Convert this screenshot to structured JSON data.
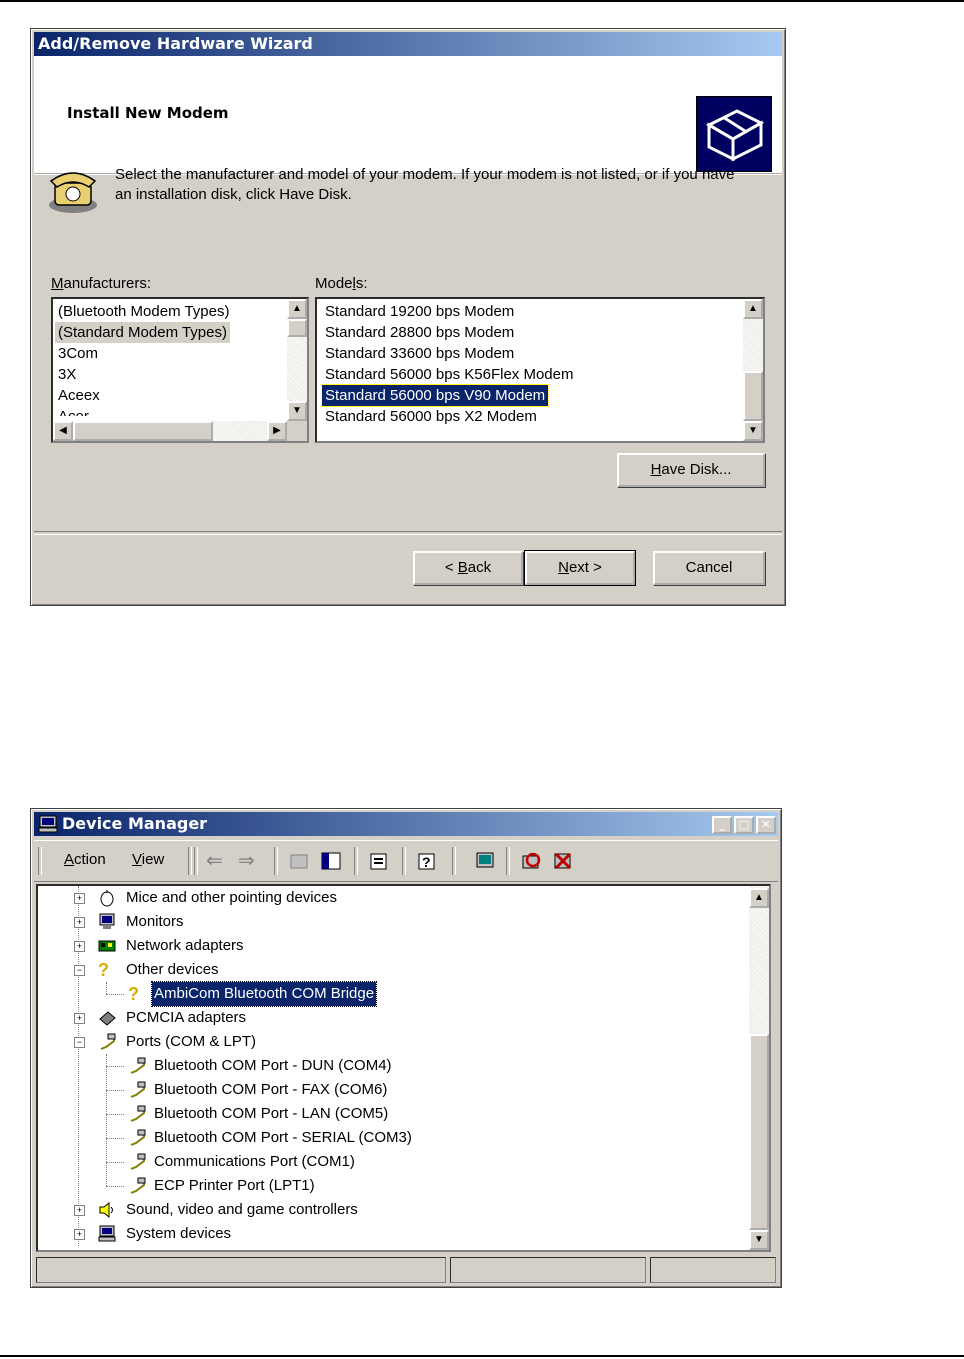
{
  "wizard": {
    "title": "Add/Remove Hardware Wizard",
    "header_title": "Install New Modem",
    "intro": "Select the manufacturer and model of your modem. If your modem is not listed, or if you have an installation disk, click Have Disk.",
    "manufacturers_label_prefix": "M",
    "manufacturers_label_rest": "anufacturers:",
    "models_label_prefix": "Mode",
    "models_label_key": "l",
    "models_label_rest": "s:",
    "manufacturers": [
      "(Bluetooth Modem Types)",
      "(Standard Modem Types)",
      "3Com",
      "3X",
      "Aceex",
      "Acer"
    ],
    "models": [
      "Standard 19200 bps Modem",
      "Standard 28800 bps Modem",
      "Standard 33600 bps Modem",
      "Standard 56000 bps K56Flex Modem",
      "Standard 56000 bps V90 Modem",
      "Standard 56000 bps X2 Modem"
    ],
    "have_disk_key": "H",
    "have_disk_rest": "ave Disk...",
    "back_prefix": "< ",
    "back_key": "B",
    "back_rest": "ack",
    "next_key": "N",
    "next_rest": "ext >",
    "cancel": "Cancel"
  },
  "device_manager": {
    "title": "Device Manager",
    "menu_action_key": "A",
    "menu_action_rest": "ction",
    "menu_view_key": "V",
    "menu_view_rest": "iew",
    "tree": [
      {
        "label": "Mice and other pointing devices",
        "icon": "mouse-icon"
      },
      {
        "label": "Monitors",
        "icon": "monitor-icon"
      },
      {
        "label": "Network adapters",
        "icon": "network-card-icon"
      },
      {
        "label": "Other devices",
        "icon": "question-icon"
      },
      {
        "label": "AmbiCom Bluetooth COM Bridge",
        "icon": "question-icon"
      },
      {
        "label": "PCMCIA adapters",
        "icon": "pcmcia-icon"
      },
      {
        "label": "Ports (COM & LPT)",
        "icon": "port-icon"
      },
      {
        "label": "Bluetooth COM Port - DUN (COM4)",
        "icon": "port-icon"
      },
      {
        "label": "Bluetooth COM Port - FAX (COM6)",
        "icon": "port-icon"
      },
      {
        "label": "Bluetooth COM Port - LAN (COM5)",
        "icon": "port-icon"
      },
      {
        "label": "Bluetooth COM Port - SERIAL (COM3)",
        "icon": "port-icon"
      },
      {
        "label": "Communications Port (COM1)",
        "icon": "port-icon"
      },
      {
        "label": "ECP Printer Port (LPT1)",
        "icon": "port-icon"
      },
      {
        "label": "Sound, video and game controllers",
        "icon": "speaker-icon"
      },
      {
        "label": "System devices",
        "icon": "computer-icon"
      }
    ]
  },
  "colors": {
    "titlebar_start": "#0a246a",
    "titlebar_end": "#a6caf0",
    "face": "#d4d0c8",
    "selection": "#0a246a"
  }
}
